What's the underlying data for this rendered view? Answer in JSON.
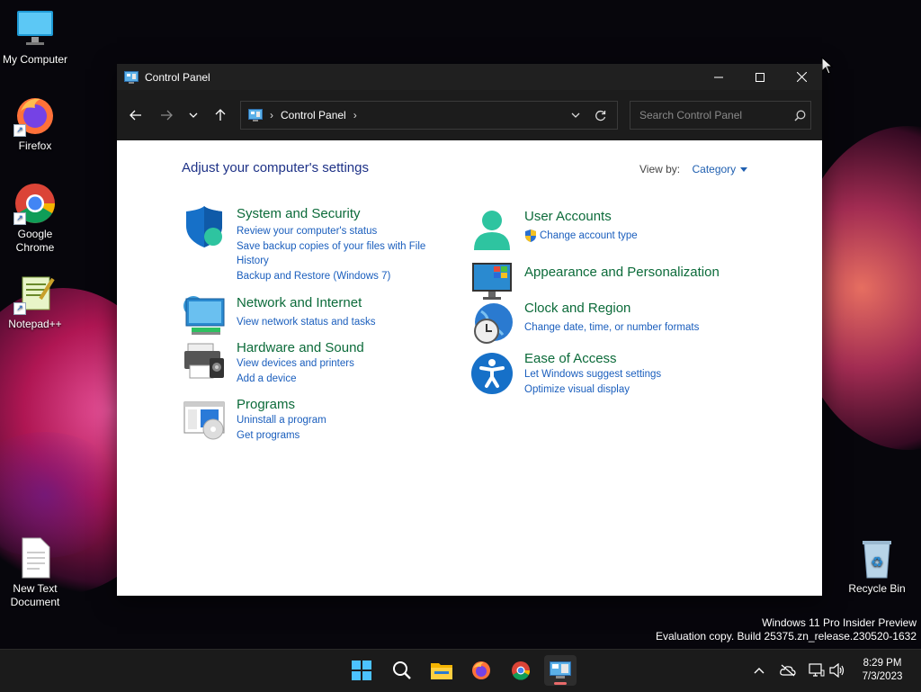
{
  "desktop": {
    "icons": [
      {
        "label": "My Computer"
      },
      {
        "label": "Firefox"
      },
      {
        "label": "Google Chrome"
      },
      {
        "label": "Notepad++"
      },
      {
        "label": "New Text Document"
      },
      {
        "label": "Recycle Bin"
      }
    ],
    "watermark": {
      "line1": "Windows 11 Pro Insider Preview",
      "line2": "Evaluation copy. Build 25375.zn_release.230520-1632"
    }
  },
  "window": {
    "title": "Control Panel",
    "icon": "control-panel-icon",
    "controls": [
      "minimize-icon",
      "maximize-icon",
      "close-icon"
    ],
    "address": {
      "crumbs": [
        "Control Panel"
      ]
    },
    "search": {
      "placeholder": "Search Control Panel"
    },
    "heading": "Adjust your computer's settings",
    "view_by": {
      "label": "View by:",
      "value": "Category"
    },
    "categories": [
      {
        "title": "System and Security",
        "icon": "shield-icon",
        "links": [
          "Review your computer's status",
          "Save backup copies of your files with File",
          "History",
          "Backup and Restore (Windows 7)"
        ]
      },
      {
        "title": "Network and Internet",
        "icon": "network-icon",
        "links": [
          "View network status and tasks"
        ]
      },
      {
        "title": "Hardware and Sound",
        "icon": "printer-icon",
        "links": [
          "View devices and printers",
          "Add a device"
        ]
      },
      {
        "title": "Programs",
        "icon": "programs-icon",
        "links": [
          "Uninstall a program",
          "Get programs"
        ]
      },
      {
        "title": "User Accounts",
        "icon": "user-icon",
        "links": [
          "Change account type"
        ]
      },
      {
        "title": "Appearance and Personalization",
        "icon": "monitor-icon",
        "links": []
      },
      {
        "title": "Clock and Region",
        "icon": "clock-globe-icon",
        "links": [
          "Change date, time, or number formats"
        ]
      },
      {
        "title": "Ease of Access",
        "icon": "accessibility-icon",
        "links": [
          "Let Windows suggest settings",
          "Optimize visual display"
        ]
      }
    ]
  },
  "taskbar": {
    "apps": [
      "start-icon",
      "search-icon",
      "file-explorer-icon",
      "firefox-icon",
      "chrome-icon",
      "control-panel-icon"
    ],
    "clock": {
      "time": "8:29 PM",
      "date": "7/3/2023"
    },
    "colors": {
      "accent": "#0078d4",
      "link": "#1a5ebd",
      "category_title": "#0c6b3a"
    }
  }
}
